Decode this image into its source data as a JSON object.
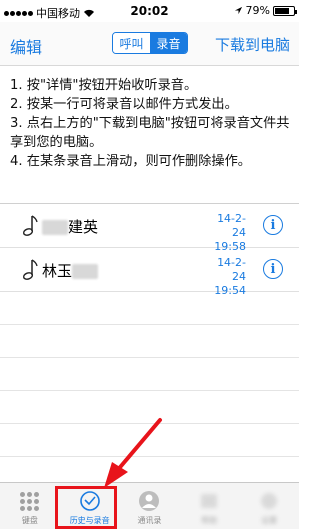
{
  "status": {
    "carrier": "中国移动",
    "time": "20:02",
    "battery": "79%",
    "battery_level": 0.79
  },
  "nav": {
    "left_label": "编辑",
    "segment_call": "呼叫",
    "segment_record": "录音",
    "right_label": "下载到电脑"
  },
  "instructions": [
    "1. 按\"详情\"按钮开始收听录音。",
    "2. 按某一行可将录音以邮件方式发出。",
    "3. 点右上方的\"下载到电脑\"按钮可将录音文件共享到您的电脑。",
    "4. 在某条录音上滑动，则可作删除操作。"
  ],
  "recordings": [
    {
      "name_prefix": "",
      "name_suffix": "建英",
      "date": "14-2-24",
      "time": "19:58"
    },
    {
      "name_prefix": "林玉",
      "name_suffix": "",
      "date": "14-2-24",
      "time": "19:54"
    }
  ],
  "tabs": [
    {
      "label": "键盘",
      "icon": "keypad-icon"
    },
    {
      "label": "历史与录音",
      "icon": "history-clock-icon"
    },
    {
      "label": "通讯录",
      "icon": "contacts-icon"
    },
    {
      "label": "帮助",
      "icon": "help-icon"
    },
    {
      "label": "设置",
      "icon": "settings-icon"
    }
  ],
  "colors": {
    "accent": "#1a7be0",
    "highlight": "#e8141b"
  }
}
